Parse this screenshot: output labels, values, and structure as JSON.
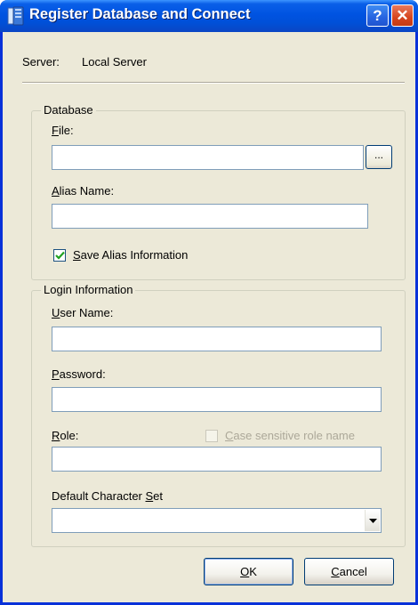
{
  "window": {
    "title": "Register Database and Connect",
    "help_glyph": "?",
    "close_glyph": "✕"
  },
  "server": {
    "label": "Server:",
    "value": "Local Server"
  },
  "database_group": {
    "legend": "Database",
    "file_label_mnemonic": "F",
    "file_label_rest": "ile:",
    "file_value": "",
    "browse_label": "...",
    "alias_label_mnemonic": "A",
    "alias_label_rest": "lias Name:",
    "alias_value": "",
    "save_alias_mnemonic": "S",
    "save_alias_rest": "ave Alias Information",
    "save_alias_checked": true
  },
  "login_group": {
    "legend": "Login Information",
    "username_label_mnemonic": "U",
    "username_label_rest": "ser Name:",
    "username_value": "",
    "password_label_mnemonic": "P",
    "password_label_rest": "assword:",
    "password_value": "",
    "role_label_mnemonic": "R",
    "role_label_rest": "ole:",
    "role_value": "",
    "case_sensitive_mnemonic": "C",
    "case_sensitive_rest": "ase sensitive role name",
    "case_sensitive_checked": false,
    "case_sensitive_enabled": false,
    "charset_label_prefix": "Default Character ",
    "charset_label_mnemonic": "S",
    "charset_label_rest": "et",
    "charset_value": ""
  },
  "buttons": {
    "ok_mnemonic": "O",
    "ok_rest": "K",
    "cancel_mnemonic": "C",
    "cancel_rest": "ancel"
  },
  "colors": {
    "titlebar": "#0053e1",
    "dialog_bg": "#ece9d8",
    "field_border": "#7f9db9",
    "disabled_text": "#aca899"
  }
}
